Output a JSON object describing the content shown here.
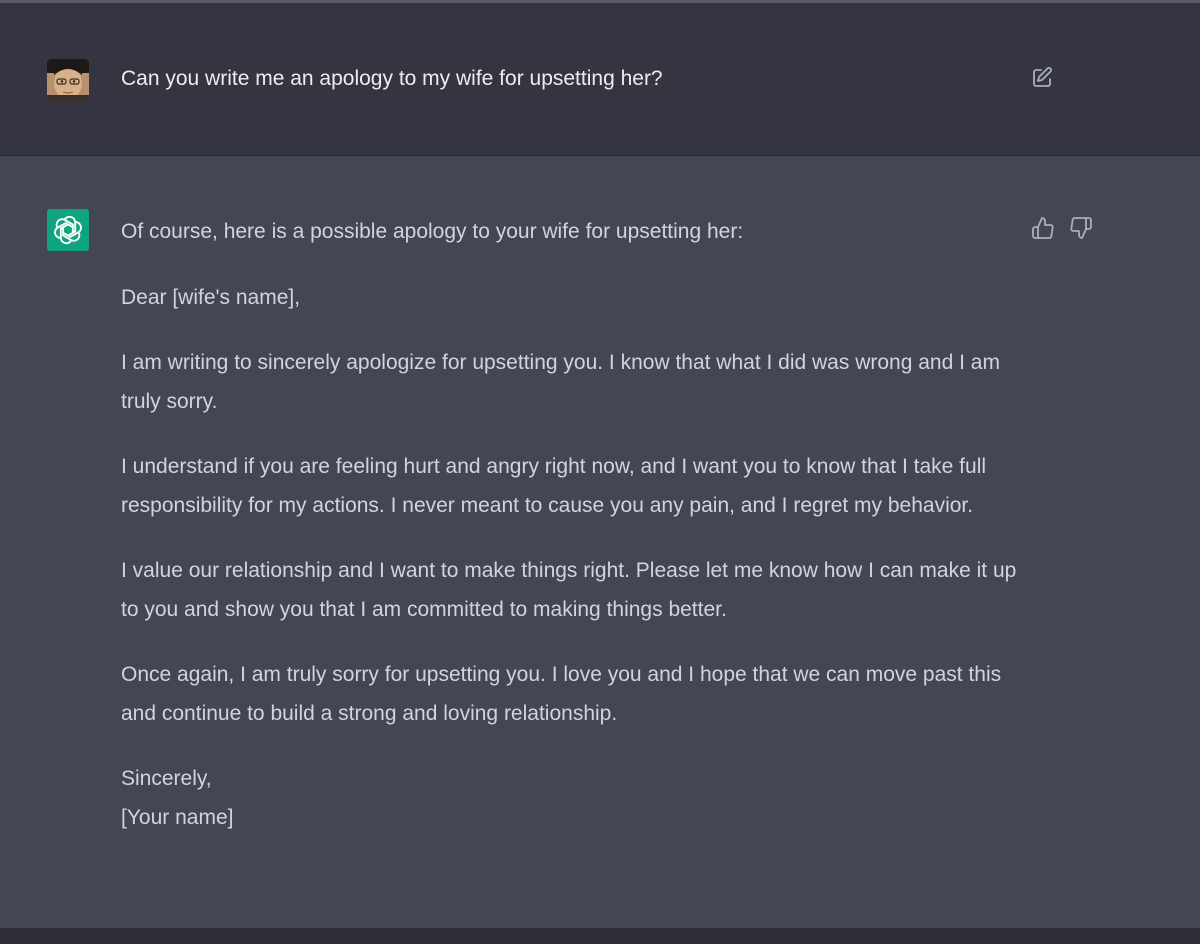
{
  "user": {
    "message": "Can you write me an apology to my wife for upsetting her?"
  },
  "assistant": {
    "intro": "Of course, here is a possible apology to your wife for upsetting her:",
    "greeting": "Dear [wife's name],",
    "paragraphs": [
      "I am writing to sincerely apologize for upsetting you. I know that what I did was wrong and I am truly sorry.",
      "I understand if you are feeling hurt and angry right now, and I want you to know that I take full responsibility for my actions. I never meant to cause you any pain, and I regret my behavior.",
      "I value our relationship and I want to make things right. Please let me know how I can make it up to you and show you that I am committed to making things better.",
      "Once again, I am truly sorry for upsetting you. I love you and I hope that we can move past this and continue to build a strong and loving relationship."
    ],
    "closing": "Sincerely,",
    "signature": "[Your name]"
  },
  "icons": {
    "edit": "edit-icon",
    "thumbs_up": "thumbs-up-icon",
    "thumbs_down": "thumbs-down-icon",
    "logo": "openai-logo-icon"
  },
  "colors": {
    "user_bg": "#343541",
    "assistant_bg": "#444654",
    "logo_bg": "#10a37f",
    "text": "#d1d5db"
  }
}
